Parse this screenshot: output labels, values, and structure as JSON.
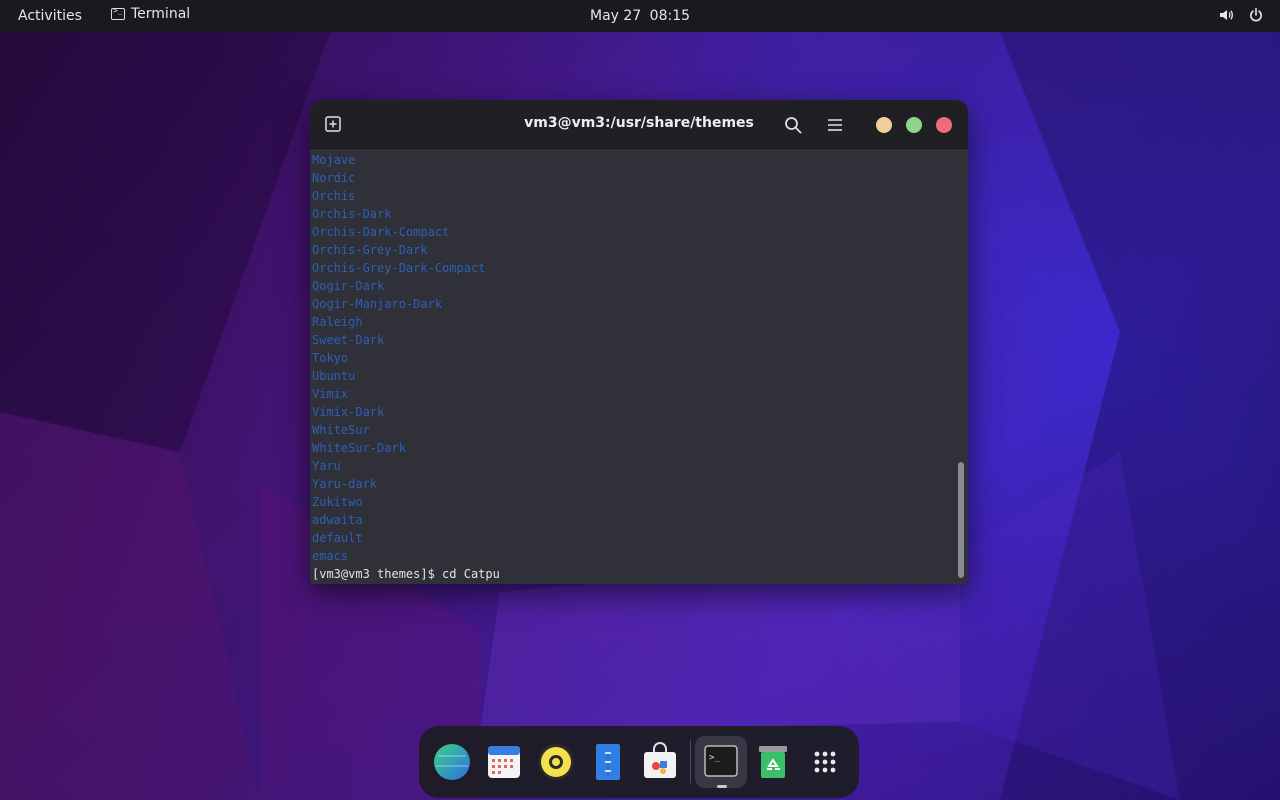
{
  "topbar": {
    "activities": "Activities",
    "app_name": "Terminal",
    "date": "May 27",
    "time": "08:15",
    "icons": [
      "terminal-icon",
      "volume-icon",
      "power-icon"
    ]
  },
  "window": {
    "title": "vm3@vm3:/usr/share/themes",
    "buttons": [
      "new-tab-icon",
      "search-icon",
      "hamburger-menu-icon",
      "minimize-button",
      "maximize-button",
      "close-button"
    ],
    "button_colors": {
      "minimize": "#f0d19b",
      "maximize": "#8fd48a",
      "close": "#ee6b77"
    },
    "terminal": {
      "listing_color": "#2f5fb8",
      "listing": [
        "Mojave",
        "Nordic",
        "Orchis",
        "Orchis-Dark",
        "Orchis-Dark-Compact",
        "Orchis-Grey-Dark",
        "Orchis-Grey-Dark-Compact",
        "Qogir-Dark",
        "Qogir-Manjaro-Dark",
        "Raleigh",
        "Sweet-Dark",
        "Tokyo",
        "Ubuntu",
        "Vimix",
        "Vimix-Dark",
        "WhiteSur",
        "WhiteSur-Dark",
        "Yaru",
        "Yaru-dark",
        "Zukitwo",
        "adwaita",
        "default",
        "emacs"
      ],
      "prompt": "[vm3@vm3 themes]$ cd Catpu"
    }
  },
  "dock": {
    "items": [
      {
        "name": "browser-icon"
      },
      {
        "name": "calendar-icon"
      },
      {
        "name": "music-player-icon"
      },
      {
        "name": "files-icon"
      },
      {
        "name": "software-store-icon"
      },
      {
        "name": "terminal-icon",
        "active": true
      },
      {
        "name": "trash-icon"
      },
      {
        "name": "app-grid-icon"
      }
    ]
  },
  "colors": {
    "accent_blue": "#2f5fb8",
    "topbar_bg": "#1a1a1e",
    "terminal_bg": "#2f3038"
  }
}
